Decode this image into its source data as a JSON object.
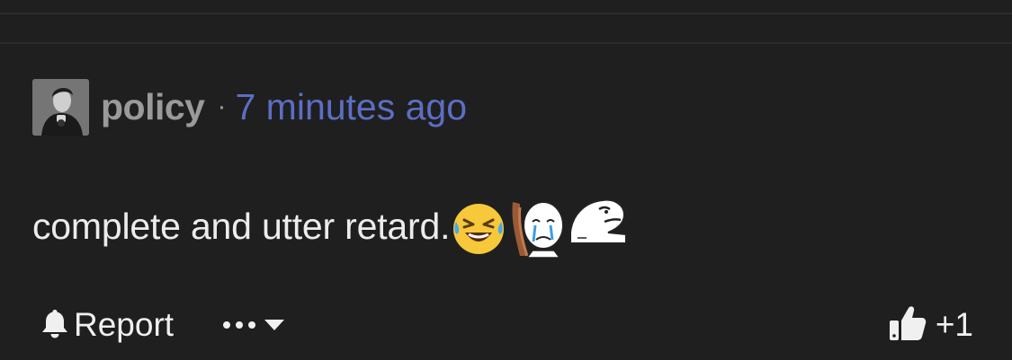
{
  "comment": {
    "author": "policy",
    "separator": "·",
    "timestamp": "7 minutes ago",
    "text": "complete and utter retard.",
    "emotes": [
      "hot-tears-emoji",
      "crying-wojak-emote",
      "smug-face-emote"
    ]
  },
  "actions": {
    "report_label": "Report",
    "more_icon": "ellipsis-icon",
    "dropdown_icon": "caret-down-icon"
  },
  "vote": {
    "icon": "thumbs-up-icon",
    "score": "+1"
  },
  "colors": {
    "background": "#1f1f1f",
    "username": "#9a9a9a",
    "timestamp_link": "#5c6ec4",
    "text": "#ececec"
  }
}
